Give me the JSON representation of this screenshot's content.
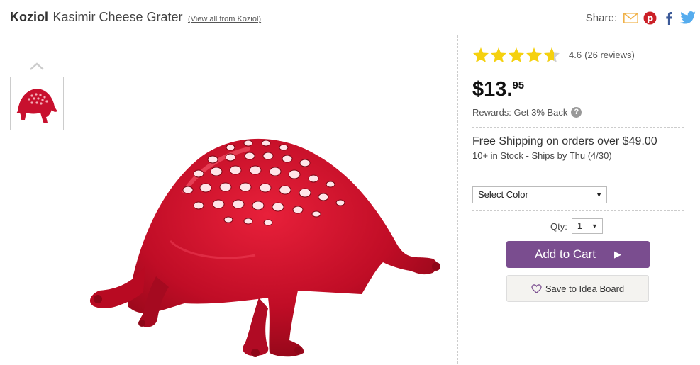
{
  "product": {
    "brand": "Koziol",
    "title": "Kasimir Cheese Grater",
    "view_all": "(View all from Koziol)"
  },
  "share": {
    "label": "Share:",
    "icons": [
      "mail-icon",
      "pinterest-icon",
      "facebook-icon",
      "twitter-icon"
    ],
    "colors": {
      "mail": "#f0b24a",
      "pinterest": "#cb2027",
      "facebook": "#3b5998",
      "twitter": "#55acee"
    }
  },
  "rating": {
    "value": "4.6",
    "reviews": "(26 reviews)",
    "stars_filled": 4.6,
    "star_color": "#f5d10f"
  },
  "price": {
    "main": "$13.",
    "cents": "95"
  },
  "rewards": {
    "text": "Rewards: Get 3% Back",
    "help": "?"
  },
  "shipping": {
    "headline": "Free Shipping on orders over $49.00",
    "stock": "10+ in Stock - Ships by Thu (4/30)"
  },
  "options": {
    "color_select": "Select Color",
    "qty_label": "Qty:",
    "qty_value": "1"
  },
  "actions": {
    "add_to_cart": "Add to Cart",
    "save_idea": "Save to Idea Board",
    "cart_color": "#7a4d8f"
  }
}
